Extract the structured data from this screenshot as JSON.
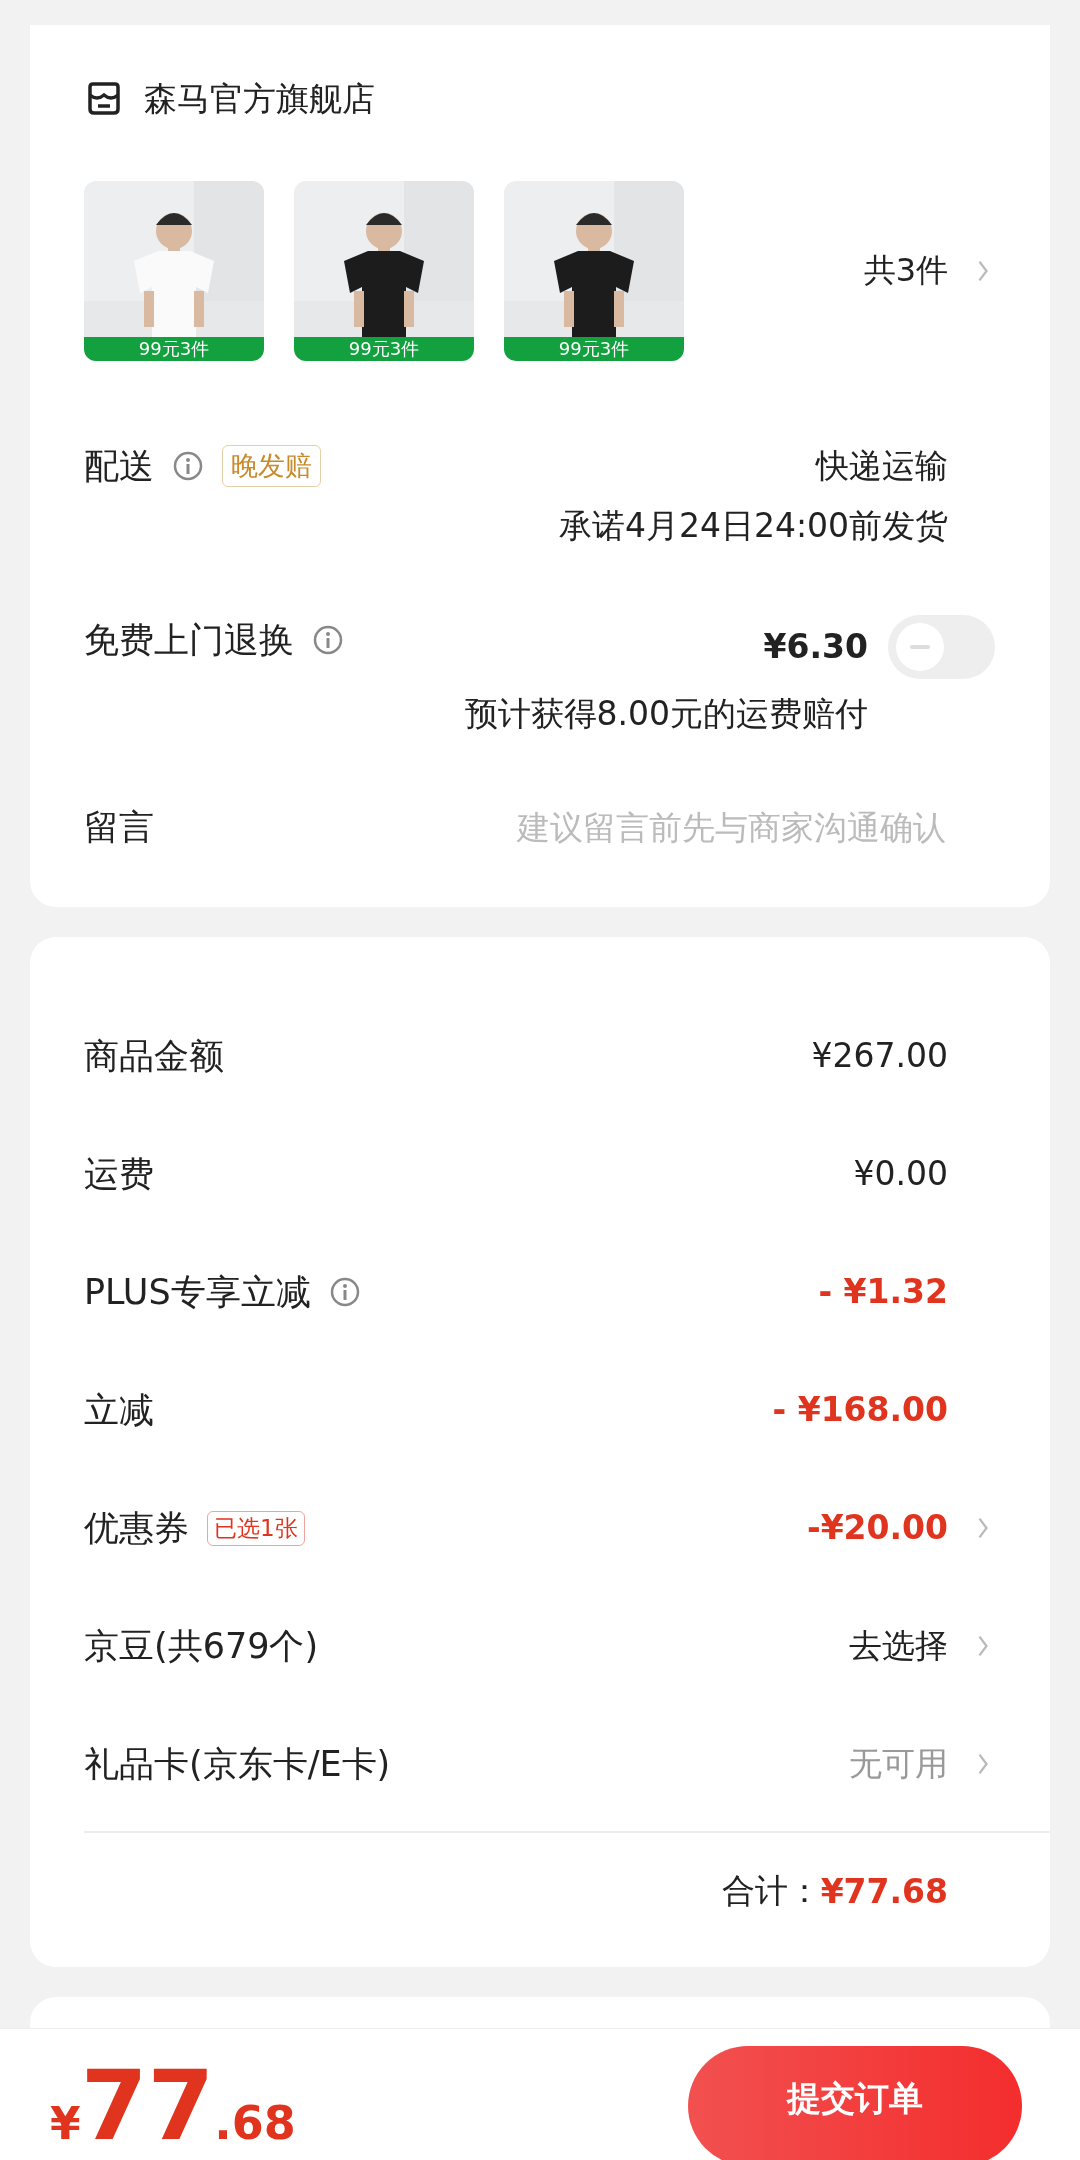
{
  "store": {
    "name": "森马官方旗舰店"
  },
  "products": {
    "items": [
      {
        "kind": "picture",
        "badge": "99元3件"
      },
      {
        "kind": "picture",
        "badge": "99元3件"
      },
      {
        "kind": "picture",
        "badge": "99元3件"
      }
    ],
    "count": "共3件"
  },
  "delivery": {
    "label": "配送",
    "tag": "晚发赔",
    "method": "快递运输",
    "promise": "承诺4月24日24:00前发货"
  },
  "return_service": {
    "label": "免费上门退换",
    "price": "¥6.30",
    "on": false,
    "note": "预计获得8.00元的运费赔付"
  },
  "message": {
    "label": "留言",
    "placeholder": "建议留言前先与商家沟通确认"
  },
  "summary": {
    "rows": [
      {
        "label": "商品金额",
        "info": false,
        "value": "¥267.00",
        "kind": "plain",
        "arrow": false
      },
      {
        "label": "运费",
        "info": false,
        "value": "¥0.00",
        "kind": "plain",
        "arrow": false
      },
      {
        "label": "PLUS专享立减",
        "info": true,
        "value": "- ¥1.32",
        "kind": "discount",
        "arrow": false
      },
      {
        "label": "立减",
        "info": false,
        "value": "- ¥168.00",
        "kind": "discount",
        "arrow": false
      },
      {
        "label": "优惠券",
        "info": false,
        "tag": "已选1张",
        "value": "-¥20.00",
        "kind": "discount",
        "arrow": true
      },
      {
        "label": "京豆(共679个)",
        "info": false,
        "value": "去选择",
        "kind": "plain",
        "arrow": true
      },
      {
        "label": "礼品卡(京东卡/E卡)",
        "info": false,
        "value": "无可用",
        "kind": "muted",
        "arrow": true
      }
    ],
    "total_label": "合计：",
    "total": "¥77.68"
  },
  "footer": {
    "currency": "¥",
    "integer": "77",
    "decimal": ".68",
    "submit": "提交订单"
  }
}
